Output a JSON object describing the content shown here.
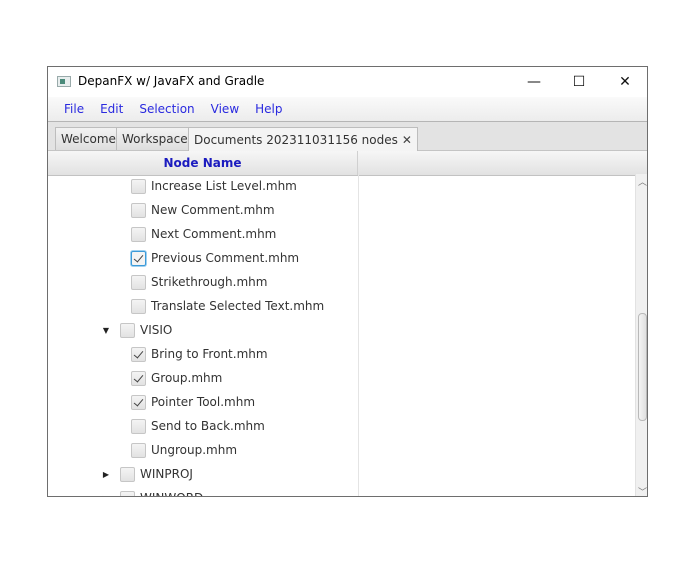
{
  "window": {
    "title": "DepanFX w/ JavaFX and Gradle",
    "controls": {
      "minimize": "—",
      "maximize": "☐",
      "close": "✕"
    }
  },
  "menu": [
    "File",
    "Edit",
    "Selection",
    "View",
    "Help"
  ],
  "tabs": [
    {
      "label": "Welcome",
      "active": false
    },
    {
      "label": "Workspace",
      "active": false
    },
    {
      "label": "Documents 202311031156 nodes",
      "active": true,
      "close": "✕"
    }
  ],
  "table": {
    "column_header": "Node Name",
    "rows": [
      {
        "label": "Increase List Level.mhm",
        "level": 2,
        "checked": false
      },
      {
        "label": "New Comment.mhm",
        "level": 2,
        "checked": false
      },
      {
        "label": "Next Comment.mhm",
        "level": 2,
        "checked": false
      },
      {
        "label": "Previous Comment.mhm",
        "level": 2,
        "checked": true,
        "focused": true
      },
      {
        "label": "Strikethrough.mhm",
        "level": 2,
        "checked": false
      },
      {
        "label": "Translate Selected Text.mhm",
        "level": 2,
        "checked": false
      },
      {
        "label": "VISIO",
        "level": 1,
        "checked": false,
        "expanded": true,
        "disclosure": "▼"
      },
      {
        "label": "Bring to Front.mhm",
        "level": 2,
        "checked": true
      },
      {
        "label": "Group.mhm",
        "level": 2,
        "checked": true
      },
      {
        "label": "Pointer Tool.mhm",
        "level": 2,
        "checked": true
      },
      {
        "label": "Send to Back.mhm",
        "level": 2,
        "checked": false
      },
      {
        "label": "Ungroup.mhm",
        "level": 2,
        "checked": false
      },
      {
        "label": "WINPROJ",
        "level": 1,
        "checked": false,
        "expanded": false,
        "disclosure": "▶"
      },
      {
        "label": "WINWORD",
        "level": 1,
        "checked": false,
        "expanded": false,
        "disclosure": "▶"
      }
    ]
  },
  "scrollbar": {
    "up": "︿",
    "down": "﹀"
  }
}
